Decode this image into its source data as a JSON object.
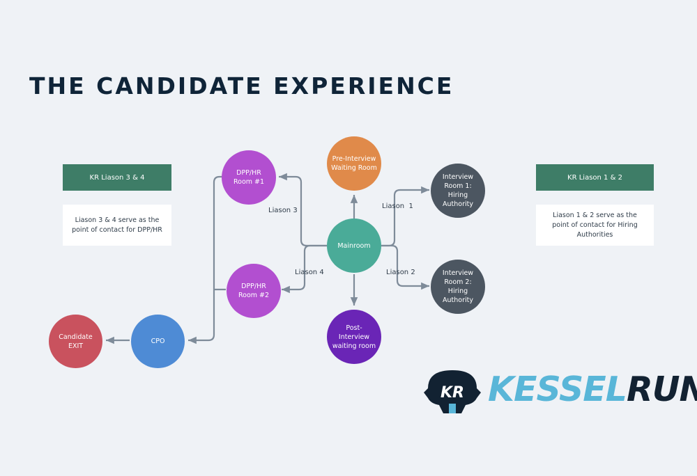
{
  "title": "THE CANDIDATE EXPERIENCE",
  "nodes": {
    "pre_interview": "Pre-Interview\nWaiting Room",
    "dpp_hr_1": "DPP/HR\nRoom #1",
    "interview_1": "Interview\nRoom 1:\nHiring\nAuthority",
    "mainroom": "Mainroom",
    "dpp_hr_2": "DPP/HR\nRoom #2",
    "interview_2": "Interview\nRoom 2:\nHiring\nAuthority",
    "post_interview": "Post-Interview\nwaiting room",
    "candidate_exit": "Candidate EXIT",
    "cpo": "CPO"
  },
  "edge_labels": {
    "liason_3": "Liason 3",
    "liason_1": "Liason  1",
    "liason_4": "Liason 4",
    "liason_2": "Liason 2"
  },
  "panels": {
    "left": {
      "header": "KR Liason 3 & 4",
      "note": "Liason 3 & 4 serve as the point of contact for DPP/HR"
    },
    "right": {
      "header": "KR Liason 1 & 2",
      "note": "Liason 1 & 2 serve as the point of contact for Hiring Authorities"
    }
  },
  "logo": {
    "emblem_text": "KR",
    "word_part1": "KESSEL",
    "word_part2": "RUN"
  },
  "colors": {
    "pre_interview": "#e08a4a",
    "dpp_hr": "#b24fd0",
    "interview": "#4c5661",
    "mainroom": "#4aab98",
    "post_interview": "#6a25b6",
    "candidate_exit": "#c9525e",
    "cpo": "#4e8bd5",
    "panel_header": "#3e7d67",
    "connector": "#7e8b99",
    "title": "#0f2438"
  },
  "icons": {
    "logo_emblem": "kessel-run-emblem-icon"
  }
}
